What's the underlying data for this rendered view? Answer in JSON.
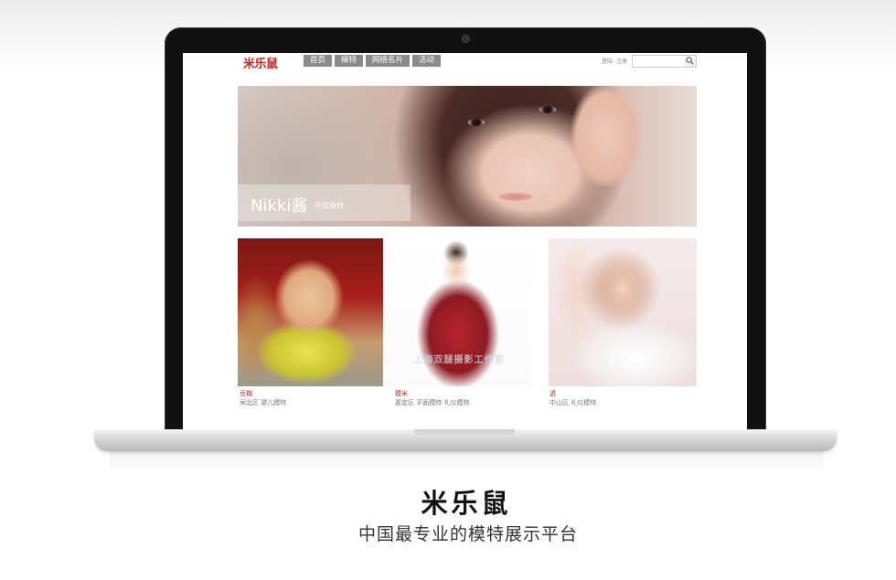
{
  "site": {
    "logo": "米乐鼠",
    "nav": [
      "首页",
      "模特",
      "网络名片",
      "活动"
    ],
    "auth": {
      "login": "登陆",
      "register": "注册"
    },
    "search": {
      "placeholder": ""
    }
  },
  "hero": {
    "name": "Nikki酱",
    "role": "平面模特"
  },
  "cards": [
    {
      "name": "豆糊",
      "tags": "闸北区  婴儿模特"
    },
    {
      "name": "模米",
      "tags": "嘉定区  平面模特  礼仪模特"
    },
    {
      "name": "透",
      "tags": "中山区  礼仪模特"
    }
  ],
  "watermark": "上海双腿摄影工作室",
  "brand": {
    "title": "米乐鼠",
    "tagline": "中国最专业的模特展示平台"
  },
  "colors": {
    "accent": "#d2211b",
    "nav_bg": "#8a8a8a"
  }
}
